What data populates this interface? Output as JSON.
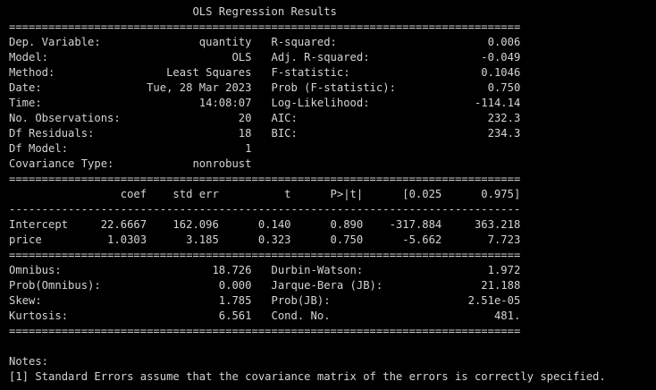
{
  "colors": {
    "background": "#000000",
    "text": "#d4d4d4"
  },
  "ols_summary": {
    "lines": [
      "                            OLS Regression Results                            ",
      "==============================================================================",
      "Dep. Variable:               quantity   R-squared:                       0.006",
      "Model:                            OLS   Adj. R-squared:                 -0.049",
      "Method:                 Least Squares   F-statistic:                    0.1046",
      "Date:                Tue, 28 Mar 2023   Prob (F-statistic):              0.750",
      "Time:                        14:08:07   Log-Likelihood:                -114.14",
      "No. Observations:                  20   AIC:                             232.3",
      "Df Residuals:                      18   BIC:                             234.3",
      "Df Model:                           1                                         ",
      "Covariance Type:            nonrobust                                         ",
      "==============================================================================",
      "                 coef    std err          t      P>|t|      [0.025      0.975]",
      "------------------------------------------------------------------------------",
      "Intercept     22.6667    162.096      0.140      0.890    -317.884     363.218",
      "price          1.0303      3.185      0.323      0.750      -5.662       7.723",
      "==============================================================================",
      "Omnibus:                       18.726   Durbin-Watson:                   1.972",
      "Prob(Omnibus):                  0.000   Jarque-Bera (JB):               21.188",
      "Skew:                           1.785   Prob(JB):                     2.51e-05",
      "Kurtosis:                       6.561   Cond. No.                         481.",
      "==============================================================================",
      "",
      "Notes:",
      "[1] Standard Errors assume that the covariance matrix of the errors is correctly specified."
    ]
  }
}
